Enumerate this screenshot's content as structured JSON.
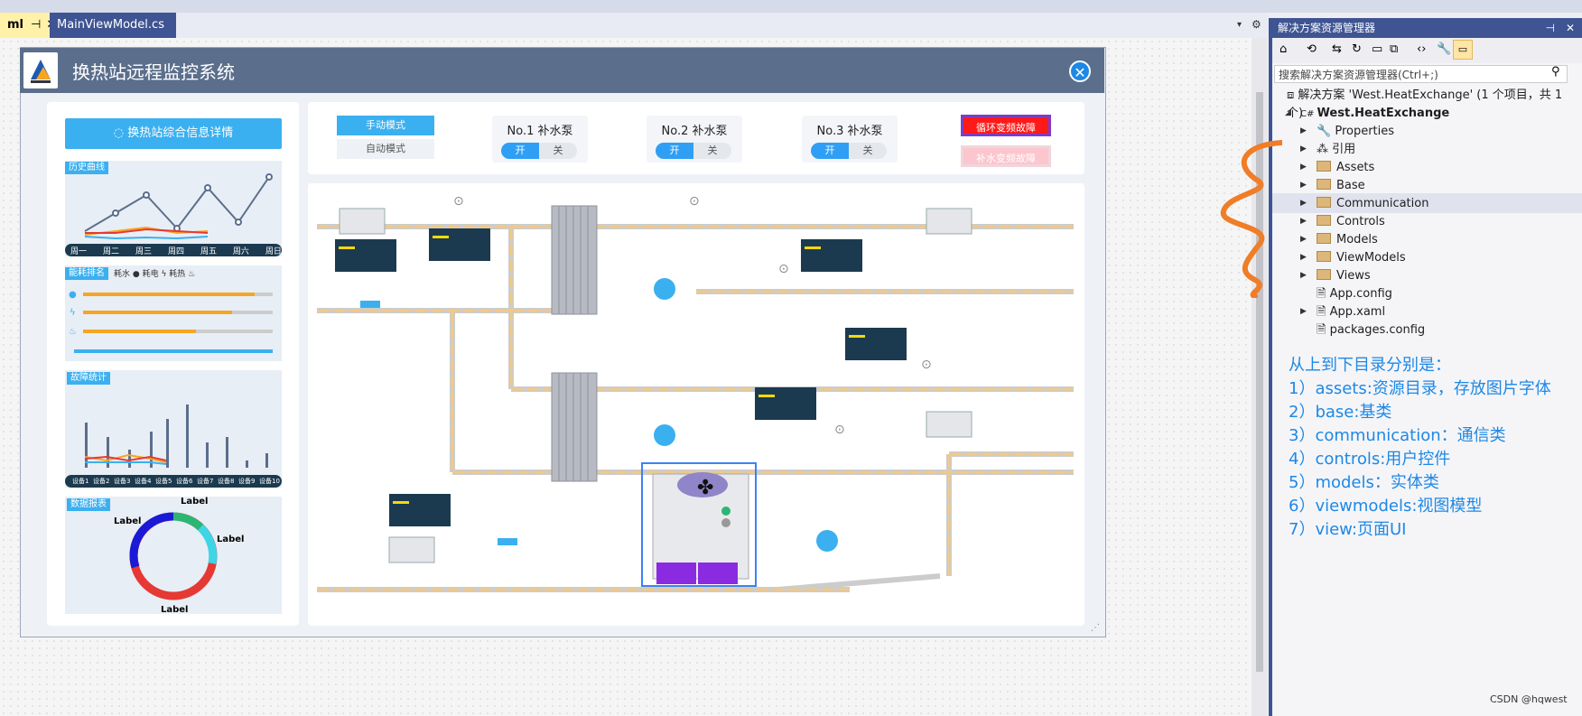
{
  "ide": {
    "tabs": [
      {
        "label": "ml",
        "pinned": true
      },
      {
        "label": "MainViewModel.cs"
      }
    ]
  },
  "app": {
    "title": "换热站远程监控系统",
    "info_button": "换热站综合信息详情",
    "sections": {
      "history": {
        "label": "历史曲线",
        "days": [
          "周一",
          "周二",
          "周三",
          "周四",
          "周五",
          "周六",
          "周日"
        ]
      },
      "energy": {
        "label": "能耗排名",
        "legend": [
          "耗水",
          "耗电",
          "耗热"
        ]
      },
      "fault": {
        "label": "故障统计",
        "devices": [
          "设备1",
          "设备2",
          "设备3",
          "设备4",
          "设备5",
          "设备6",
          "设备7",
          "设备8",
          "设备9",
          "设备10"
        ]
      },
      "report": {
        "label": "数据报表",
        "labels": [
          "Label",
          "Label",
          "Label",
          "Label"
        ]
      }
    },
    "modes": {
      "manual": "手动模式",
      "auto": "自动模式"
    },
    "pumps": [
      {
        "name": "No.1 补水泵",
        "on": "开",
        "off": "关"
      },
      {
        "name": "No.2 补水泵",
        "on": "开",
        "off": "关"
      },
      {
        "name": "No.3 补水泵",
        "on": "开",
        "off": "关"
      }
    ],
    "alarms": {
      "circ": "循环变频故障",
      "supply": "补水变频故障"
    }
  },
  "solution_explorer": {
    "title": "解决方案资源管理器",
    "search_placeholder": "搜索解决方案资源管理器(Ctrl+;)",
    "solution": "解决方案 'West.HeatExchange' (1 个项目，共 1 个)",
    "project": "West.HeatExchange",
    "items": [
      "Properties",
      "引用",
      "Assets",
      "Base",
      "Communication",
      "Controls",
      "Models",
      "ViewModels",
      "Views",
      "App.config",
      "App.xaml",
      "packages.config"
    ]
  },
  "notes": {
    "heading": "从上到下目录分别是：",
    "lines": [
      "1）assets:资源目录，存放图片字体",
      "2）base:基类",
      "3）communication：通信类",
      "4）controls:用户控件",
      "5）models：实体类",
      "6）viewmodels:视图模型",
      "7）view:页面UI"
    ]
  },
  "watermark": "CSDN @hqwest"
}
